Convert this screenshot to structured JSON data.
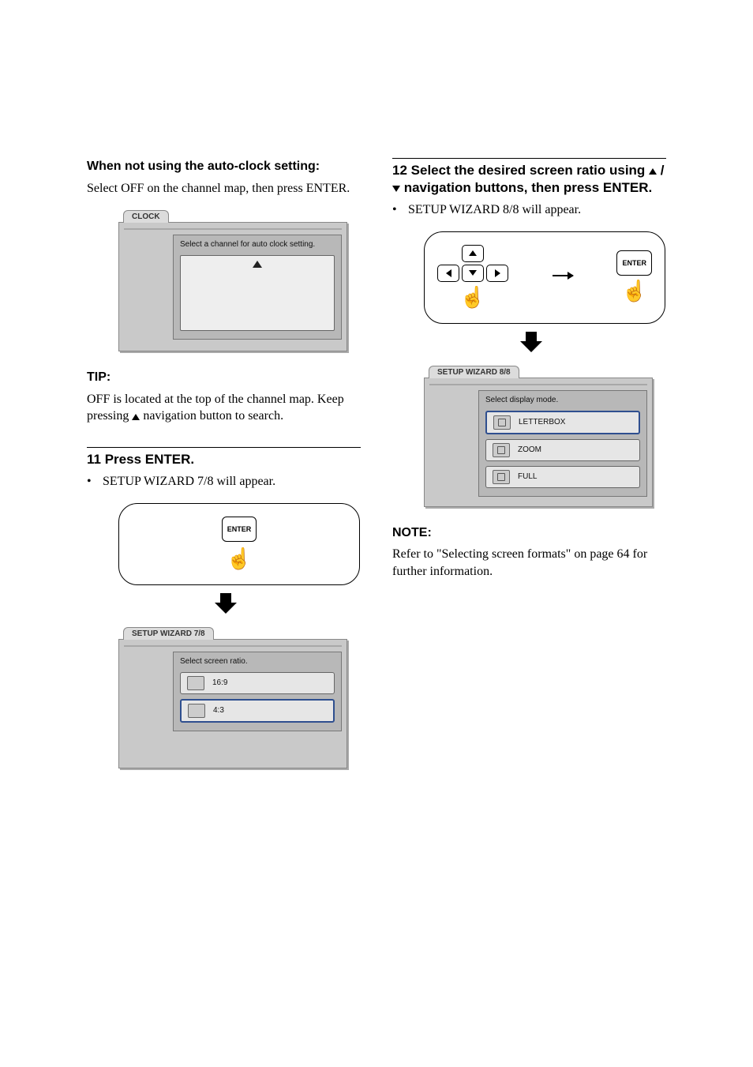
{
  "left": {
    "h_autoclock": "When not using the auto-clock setting:",
    "p_autoclock": "Select OFF on the channel map, then press ENTER.",
    "clock_tab": "CLOCK",
    "clock_inner_title": "Select a channel for  auto clock setting.",
    "tip_label": "TIP:",
    "tip_body_a": "OFF is located at the top of the channel map. Keep pressing ",
    "tip_body_b": " navigation button to search.",
    "step11_num": "11",
    "step11_title": "Press ENTER.",
    "step11_bullet": "SETUP WIZARD 7/8 will appear.",
    "enter_label": "ENTER",
    "wizard7_tab": "SETUP WIZARD 7/8",
    "wizard7_inner_title": "Select  screen  ratio.",
    "ratio_169": "16:9",
    "ratio_43": "4:3"
  },
  "right": {
    "step12_num": "12",
    "step12_line1_a": "Select the desired screen ratio using ",
    "step12_line1_b": " / ",
    "step12_line2": " navigation buttons, then press ENTER.",
    "step12_bullet": "SETUP WIZARD 8/8 will appear.",
    "enter_label": "ENTER",
    "wizard8_tab": "SETUP WIZARD 8/8",
    "wizard8_inner_title": "Select  display mode.",
    "mode_letterbox": "LETTERBOX",
    "mode_zoom": "ZOOM",
    "mode_full": "FULL",
    "note_label": "NOTE:",
    "note_body": "Refer to \"Selecting screen formats\" on page 64 for further information."
  }
}
